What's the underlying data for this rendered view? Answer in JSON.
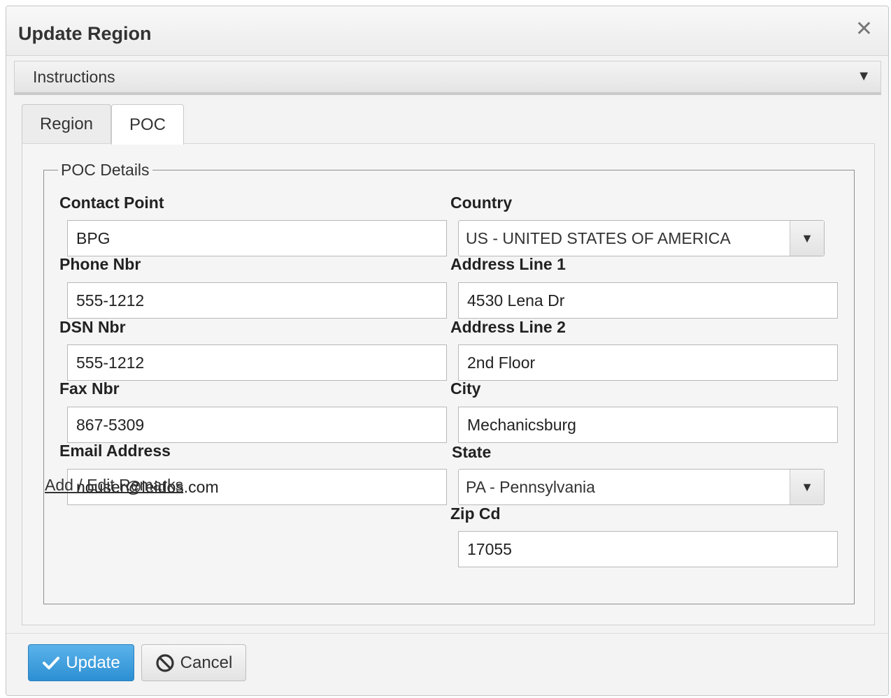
{
  "dialog": {
    "title": "Update Region",
    "close_icon": "close-icon"
  },
  "instructions": {
    "label": "Instructions",
    "caret": "▼"
  },
  "tabs": [
    {
      "label": "Region",
      "active": false
    },
    {
      "label": "POC",
      "active": true
    }
  ],
  "poc": {
    "legend": "POC Details",
    "contact_point": {
      "label": "Contact Point",
      "value": "BPG"
    },
    "phone_nbr": {
      "label": "Phone Nbr",
      "value": "555-1212"
    },
    "dsn_nbr": {
      "label": "DSN Nbr",
      "value": "555-1212"
    },
    "fax_nbr": {
      "label": "Fax Nbr",
      "value": "867-5309"
    },
    "email": {
      "label": "Email Address",
      "value": "nouser@leidos.com"
    },
    "country": {
      "label": "Country",
      "value": "US - UNITED STATES OF AMERICA"
    },
    "address1": {
      "label": "Address Line 1",
      "value": "4530 Lena Dr"
    },
    "address2": {
      "label": "Address Line 2",
      "value": "2nd Floor"
    },
    "city": {
      "label": "City",
      "value": "Mechanicsburg"
    },
    "state": {
      "label": "State",
      "value": "PA - Pennsylvania"
    },
    "zip": {
      "label": "Zip Cd",
      "value": "17055"
    },
    "remarks_link": "Add / Edit Remarks"
  },
  "footer": {
    "update_label": "Update",
    "cancel_label": "Cancel"
  },
  "colors": {
    "primary_button": "#2c8fd3",
    "background": "#f3f3f3"
  }
}
